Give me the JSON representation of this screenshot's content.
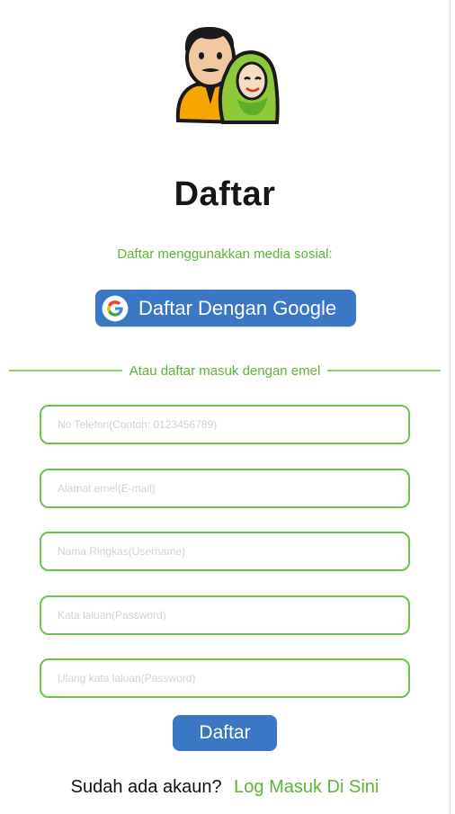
{
  "header": {
    "logo_icon": "couple-avatar-icon",
    "title": "Daftar",
    "social_prompt": "Daftar menggunakkan media sosial:"
  },
  "google_button": {
    "icon": "google-g-icon",
    "label": "Daftar Dengan Google"
  },
  "divider": {
    "label": "Atau daftar masuk dengan emel"
  },
  "form": {
    "phone": {
      "placeholder": "No Telefon(Contoh: 0123456789)",
      "value": ""
    },
    "email": {
      "placeholder": "Alamat emel(E-mail)",
      "value": ""
    },
    "username": {
      "placeholder": "Nama Ringkas(Username)",
      "value": ""
    },
    "password": {
      "placeholder": "Kata laluan(Password)",
      "value": ""
    },
    "confirm_password": {
      "placeholder": "Ulang kata laluan(Password)",
      "value": ""
    },
    "submit_label": "Daftar"
  },
  "footer": {
    "question": "Sudah ada akaun?",
    "login_link": "Log Masuk Di Sini"
  },
  "colors": {
    "accent_green": "#5bb534",
    "field_border": "#6cc24a",
    "button_blue": "#3a77c4"
  }
}
